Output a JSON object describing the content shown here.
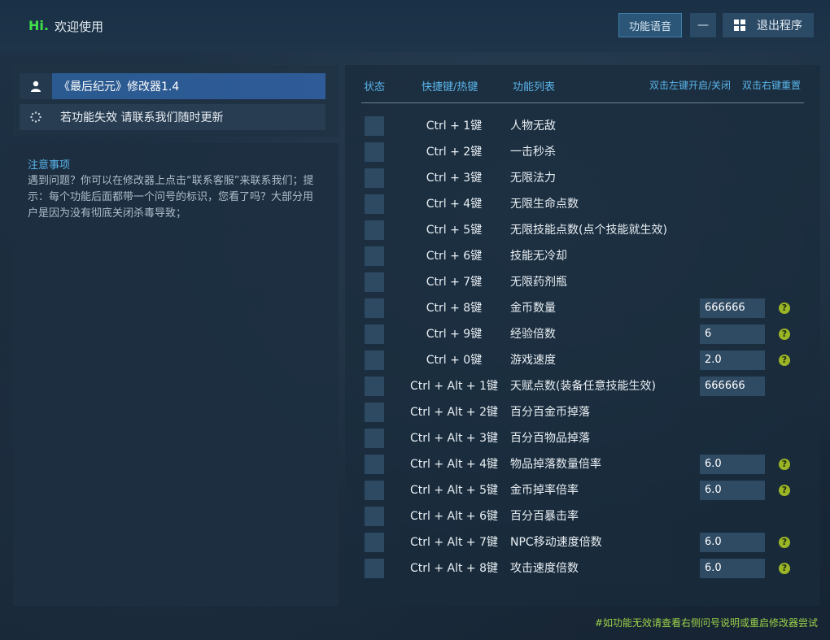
{
  "header": {
    "logo": "Hi.",
    "welcome": "欢迎使用",
    "voice_button": "功能语音",
    "minimize_button": "—",
    "exit_button": "退出程序"
  },
  "left": {
    "game_title": "《最后纪元》修改器1.4",
    "update_notice": "若功能失效  请联系我们随时更新",
    "notes_title": "注意事项",
    "notes_body": "遇到问题？你可以在修改器上点击“联系客服”来联系我们；提示：每个功能后面都带一个问号的标识，您看了吗？大部分用户是因为没有彻底关闭杀毒导致；"
  },
  "table": {
    "headers": {
      "status": "状态",
      "hotkey": "快捷键/热键",
      "features": "功能列表",
      "hint_left": "双击左键开启/关闭",
      "hint_right": "双击右键重置"
    },
    "rows": [
      {
        "hotkey": "Ctrl + 1键",
        "name": "人物无敌"
      },
      {
        "hotkey": "Ctrl + 2键",
        "name": "一击秒杀"
      },
      {
        "hotkey": "Ctrl + 3键",
        "name": "无限法力"
      },
      {
        "hotkey": "Ctrl + 4键",
        "name": "无限生命点数"
      },
      {
        "hotkey": "Ctrl + 5键",
        "name": "无限技能点数(点个技能就生效)"
      },
      {
        "hotkey": "Ctrl + 6键",
        "name": "技能无冷却"
      },
      {
        "hotkey": "Ctrl + 7键",
        "name": "无限药剂瓶"
      },
      {
        "hotkey": "Ctrl + 8键",
        "name": "金币数量",
        "value": "666666",
        "help": "?"
      },
      {
        "hotkey": "Ctrl + 9键",
        "name": "经验倍数",
        "value": "6",
        "help": "?"
      },
      {
        "hotkey": "Ctrl + 0键",
        "name": "游戏速度",
        "value": "2.0",
        "help": "?"
      },
      {
        "hotkey": "Ctrl + Alt + 1键",
        "name": "天赋点数(装备任意技能生效)",
        "value": "666666"
      },
      {
        "hotkey": "Ctrl + Alt + 2键",
        "name": "百分百金币掉落"
      },
      {
        "hotkey": "Ctrl + Alt + 3键",
        "name": "百分百物品掉落"
      },
      {
        "hotkey": "Ctrl + Alt + 4键",
        "name": "物品掉落数量倍率",
        "value": "6.0",
        "help": "?"
      },
      {
        "hotkey": "Ctrl + Alt + 5键",
        "name": "金币掉率倍率",
        "value": "6.0",
        "help": "?"
      },
      {
        "hotkey": "Ctrl + Alt + 6键",
        "name": "百分百暴击率"
      },
      {
        "hotkey": "Ctrl + Alt + 7键",
        "name": "NPC移动速度倍数",
        "value": "6.0",
        "help": "?"
      },
      {
        "hotkey": "Ctrl + Alt + 8键",
        "name": "攻击速度倍数",
        "value": "6.0",
        "help": "?"
      }
    ]
  },
  "footer": "#如功能无效请查看右侧问号说明或重启修改器尝试",
  "colors": {
    "accent_blue": "#5ab4ea",
    "logo_green": "#3fe04a",
    "help_badge": "#9ab526",
    "footer_green": "#9bd24a"
  }
}
